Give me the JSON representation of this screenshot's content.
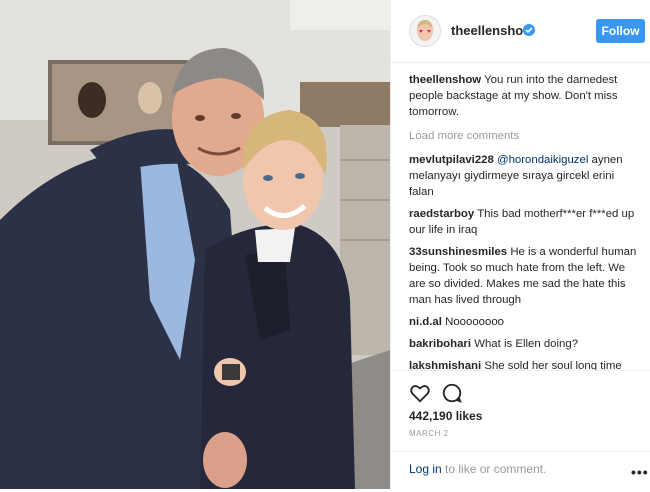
{
  "post": {
    "username": "theellenshow",
    "follow_label": "Follow"
  },
  "caption": {
    "user": "theellenshow",
    "text": "You run into the darnedest people backstage at my show. Don't miss tomorrow."
  },
  "load_more_label": "Load more comments",
  "comments": [
    {
      "user": "mevlutpilavi228",
      "mention": "@horondaikiguzel",
      "text": "aynen melanyayı giydirmeye sıraya gircekl erini falan"
    },
    {
      "user": "raedstarboy",
      "text": "This bad motherf***er f***ed up our life in iraq"
    },
    {
      "user": "33sunshinesmiles",
      "text": "He is a wonderful human being. Took so much hate from the left. We are so divided. Makes me sad the hate this man has lived through"
    },
    {
      "user": "ni.d.al",
      "text": "Noooooooo"
    },
    {
      "user": "bakribohari",
      "text": "What is Ellen doing?"
    },
    {
      "user": "lakshmishani",
      "text": "She sold her soul long time ago!!"
    }
  ],
  "likes": "442,190 likes",
  "date": "MARCH 2",
  "login": {
    "link": "Log in",
    "rest": " to like or comment."
  },
  "more_glyph": "•••",
  "icons": {
    "like": "heart-icon",
    "comment": "comment-icon",
    "verified": "verified-badge-icon",
    "more": "more-options-icon"
  },
  "colors": {
    "accent": "#3897f0",
    "link": "#003569",
    "muted": "#999999"
  }
}
